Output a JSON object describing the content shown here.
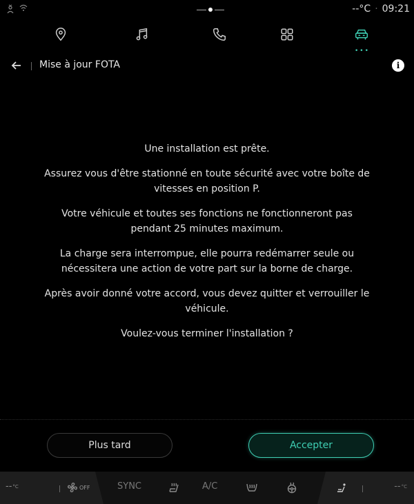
{
  "status": {
    "temperature": "--°C",
    "separator": "·",
    "time": "09:21"
  },
  "nav": {
    "items": [
      {
        "icon": "location-pin-icon"
      },
      {
        "icon": "music-note-icon"
      },
      {
        "icon": "phone-icon"
      },
      {
        "icon": "apps-grid-icon"
      },
      {
        "icon": "car-icon",
        "active": true
      }
    ],
    "more_indicator": "•••"
  },
  "header": {
    "title": "Mise à jour FOTA",
    "info_icon": "i"
  },
  "message": {
    "lines": [
      "Une installation est prête.",
      "Assurez vous d'être stationné en toute sécurité avec votre boîte de vitesses en position P.",
      "Votre véhicule et toutes ses fonctions ne fonctionneront pas pendant 25 minutes maximum.",
      "La charge sera interrompue, elle pourra redémarrer seule ou nécessitera une action de votre part sur la borne de charge.",
      "Après avoir donné votre accord, vous devez quitter et verrouiller le véhicule.",
      "Voulez-vous terminer l'installation ?"
    ]
  },
  "buttons": {
    "later": "Plus tard",
    "accept": "Accepter"
  },
  "climate": {
    "left_temp": "--",
    "left_unit": "°C",
    "fan_off": "OFF",
    "sync": "SYNC",
    "ac": "A/C",
    "right_temp": "--",
    "right_unit": "°C"
  },
  "colors": {
    "accent": "#3fcfb4",
    "background": "#000000"
  }
}
